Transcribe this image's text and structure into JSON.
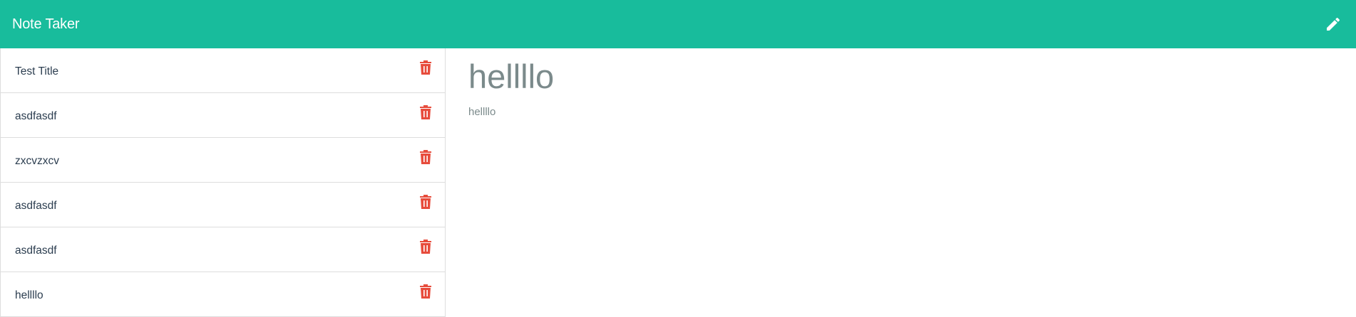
{
  "app": {
    "title": "Note Taker",
    "new_note_icon": "pencil-icon"
  },
  "notes": [
    {
      "title": "Test Title",
      "delete_icon": "trash-icon"
    },
    {
      "title": "asdfasdf",
      "delete_icon": "trash-icon"
    },
    {
      "title": "zxcvzxcv",
      "delete_icon": "trash-icon"
    },
    {
      "title": "asdfasdf",
      "delete_icon": "trash-icon"
    },
    {
      "title": "asdfasdf",
      "delete_icon": "trash-icon"
    },
    {
      "title": "hellllo",
      "delete_icon": "trash-icon"
    }
  ],
  "active_note": {
    "title": "hellllo",
    "text": "hellllo"
  },
  "colors": {
    "navbar": "#18bc9c",
    "delete": "#e74c3c",
    "text_muted": "#7b8a8b",
    "text": "#2c3e50"
  }
}
